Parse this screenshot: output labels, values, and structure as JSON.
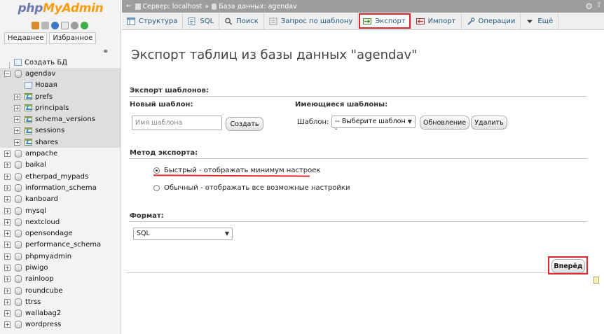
{
  "nav": {
    "logo_php": "php",
    "logo_my": "MyAdmin",
    "tabs": [
      "Недавнее",
      "Избранное"
    ],
    "tree": [
      {
        "label": "Создать БД",
        "kind": "new-db",
        "depth": 0
      },
      {
        "label": "agendav",
        "kind": "db",
        "depth": 0,
        "expanded": true,
        "active": true
      },
      {
        "label": "Новая",
        "kind": "new",
        "depth": 1,
        "active": true
      },
      {
        "label": "prefs",
        "kind": "table",
        "depth": 1,
        "active": true
      },
      {
        "label": "principals",
        "kind": "table",
        "depth": 1,
        "active": true
      },
      {
        "label": "schema_versions",
        "kind": "table",
        "depth": 1,
        "active": true
      },
      {
        "label": "sessions",
        "kind": "table",
        "depth": 1,
        "active": true
      },
      {
        "label": "shares",
        "kind": "table",
        "depth": 1,
        "active": true
      },
      {
        "label": "ampache",
        "kind": "db",
        "depth": 0
      },
      {
        "label": "baikal",
        "kind": "db",
        "depth": 0
      },
      {
        "label": "etherpad_mypads",
        "kind": "db",
        "depth": 0
      },
      {
        "label": "information_schema",
        "kind": "db",
        "depth": 0
      },
      {
        "label": "kanboard",
        "kind": "db",
        "depth": 0
      },
      {
        "label": "mysql",
        "kind": "db",
        "depth": 0
      },
      {
        "label": "nextcloud",
        "kind": "db",
        "depth": 0
      },
      {
        "label": "opensondage",
        "kind": "db",
        "depth": 0
      },
      {
        "label": "performance_schema",
        "kind": "db",
        "depth": 0
      },
      {
        "label": "phpmyadmin",
        "kind": "db",
        "depth": 0
      },
      {
        "label": "piwigo",
        "kind": "db",
        "depth": 0
      },
      {
        "label": "rainloop",
        "kind": "db",
        "depth": 0
      },
      {
        "label": "roundcube",
        "kind": "db",
        "depth": 0
      },
      {
        "label": "ttrss",
        "kind": "db",
        "depth": 0
      },
      {
        "label": "wallabag2",
        "kind": "db",
        "depth": 0
      },
      {
        "label": "wordpress",
        "kind": "db",
        "depth": 0
      }
    ]
  },
  "breadcrumb": {
    "server": "Сервер: localhost",
    "sep": "»",
    "database": "База данных: agendav"
  },
  "tabs": [
    {
      "label": "Структура",
      "icon": "structure-icon"
    },
    {
      "label": "SQL",
      "icon": "sql-icon"
    },
    {
      "label": "Поиск",
      "icon": "search-icon"
    },
    {
      "label": "Запрос по шаблону",
      "icon": "query-icon"
    },
    {
      "label": "Экспорт",
      "icon": "export-icon",
      "active": true
    },
    {
      "label": "Импорт",
      "icon": "import-icon"
    },
    {
      "label": "Операции",
      "icon": "wrench-icon"
    },
    {
      "label": "Ещё",
      "icon": "chevron-down-icon"
    }
  ],
  "page": {
    "title": "Экспорт таблиц из базы данных \"agendav\"",
    "templates": {
      "legend": "Экспорт шаблонов:",
      "new_label": "Новый шаблон:",
      "name_placeholder": "Имя шаблона",
      "create_button": "Создать",
      "existing_label": "Имеющиеся шаблоны:",
      "template_label": "Шаблон:",
      "template_select": "-- Выберите шаблон --",
      "update_button": "Обновление",
      "delete_button": "Удалить"
    },
    "method": {
      "legend": "Метод экспорта:",
      "quick": "Быстрый - отображать минимум настроек",
      "custom": "Обычный - отображать все возможные настройки",
      "selected": "quick"
    },
    "format": {
      "legend": "Формат:",
      "value": "SQL"
    },
    "go_button": "Вперёд"
  },
  "colors": {
    "highlight": "#e0262b",
    "link": "#235a81",
    "topbar": "#9d9d9d"
  }
}
